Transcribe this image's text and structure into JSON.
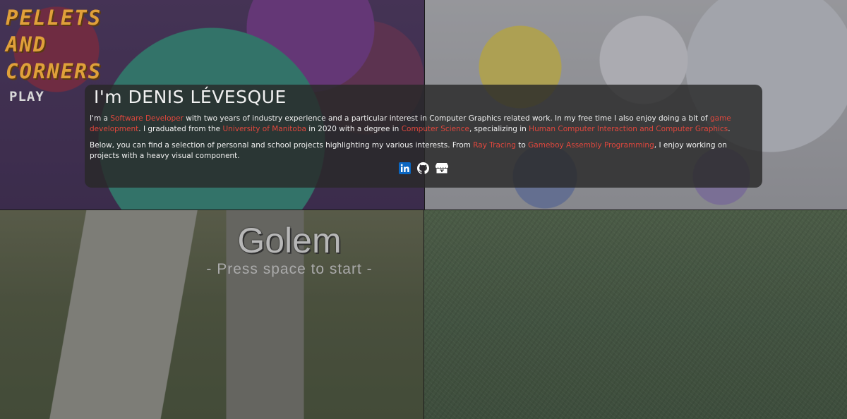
{
  "tiles": {
    "pellets": {
      "title": "PELLETS\nAND\nCORNERS",
      "play": "PLAY"
    },
    "golem": {
      "title": "Golem",
      "subtitle": "- Press space to start -"
    }
  },
  "intro": {
    "heading": "I'm DENIS LÉVESQUE",
    "p1": {
      "t1": "I'm a ",
      "l1": "Software Developer",
      "t2": " with two years of industry experience and a particular interest in Computer Graphics related work. In my free time I also enjoy doing a bit of ",
      "l2": "game development",
      "t3": ". I graduated from the ",
      "l3": "University of Manitoba",
      "t4": " in 2020 with a degree in ",
      "l4": "Computer Science",
      "t5": ", specializing in ",
      "l5": "Human Computer Interaction and Computer Graphics",
      "t6": "."
    },
    "p2": {
      "t1": "Below, you can find a selection of personal and school projects highlighting my various interests. From ",
      "l1": "Ray Tracing",
      "t2": " to ",
      "l2": "Gameboy Assembly Programming",
      "t3": ", I enjoy working on projects with a heavy visual component."
    }
  },
  "social": [
    {
      "icon": "linkedin-icon",
      "color": "#0a66c2"
    },
    {
      "icon": "github-icon",
      "color": "#ffffff"
    },
    {
      "icon": "itchio-icon",
      "color": "#ffffff"
    }
  ],
  "colors": {
    "link": "#e0473d",
    "card": "#282828",
    "text": "#f1f1f1"
  }
}
